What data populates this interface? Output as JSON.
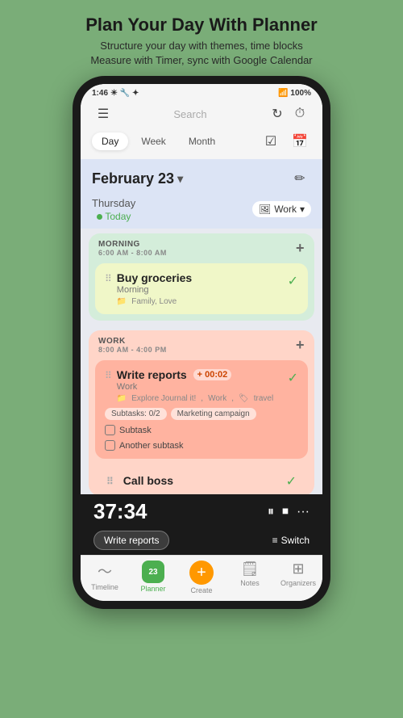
{
  "header": {
    "title": "Plan Your Day With Planner",
    "subtitle1": "Structure your day with themes, time blocks",
    "subtitle2": "Measure with Timer, sync with Google Calendar"
  },
  "statusBar": {
    "time": "1:46",
    "battery": "100%"
  },
  "searchBar": {
    "placeholder": "Search"
  },
  "tabs": {
    "items": [
      "Day",
      "Week",
      "Month"
    ],
    "active": "Day"
  },
  "dateHeader": {
    "date": "February 23",
    "dayName": "Thursday",
    "todayLabel": "Today",
    "workLabel": "Work"
  },
  "morning": {
    "sectionLabel": "MORNING",
    "timeRange": "6:00 AM - 8:00 AM",
    "task": {
      "title": "Buy groceries",
      "subLabel": "Morning",
      "tags": "Family, Love",
      "completed": true
    }
  },
  "work": {
    "sectionLabel": "WORK",
    "timeRange": "8:00 AM - 4:00 PM",
    "tasks": [
      {
        "title": "Write reports",
        "subLabel": "Work",
        "timer": "+ 00:02",
        "journalTag": "Explore Journal it!",
        "workTag": "Work",
        "travelTag": "travel",
        "subtasksLabel": "Subtasks: 0/2",
        "campaignLabel": "Marketing campaign",
        "subtask1": "Subtask",
        "subtask2": "Another subtask",
        "completed": true
      },
      {
        "title": "Call boss",
        "completed": true
      }
    ]
  },
  "timer": {
    "value": "37:34",
    "currentTask": "Write reports",
    "switchLabel": "Switch"
  },
  "bottomNav": {
    "items": [
      {
        "label": "Timeline",
        "icon": "📈"
      },
      {
        "label": "Planner",
        "icon": "📅",
        "active": true,
        "badge": "23"
      },
      {
        "label": "Create",
        "icon": "+"
      },
      {
        "label": "Notes",
        "icon": "📄"
      },
      {
        "label": "Organizers",
        "icon": "⊞"
      }
    ]
  }
}
